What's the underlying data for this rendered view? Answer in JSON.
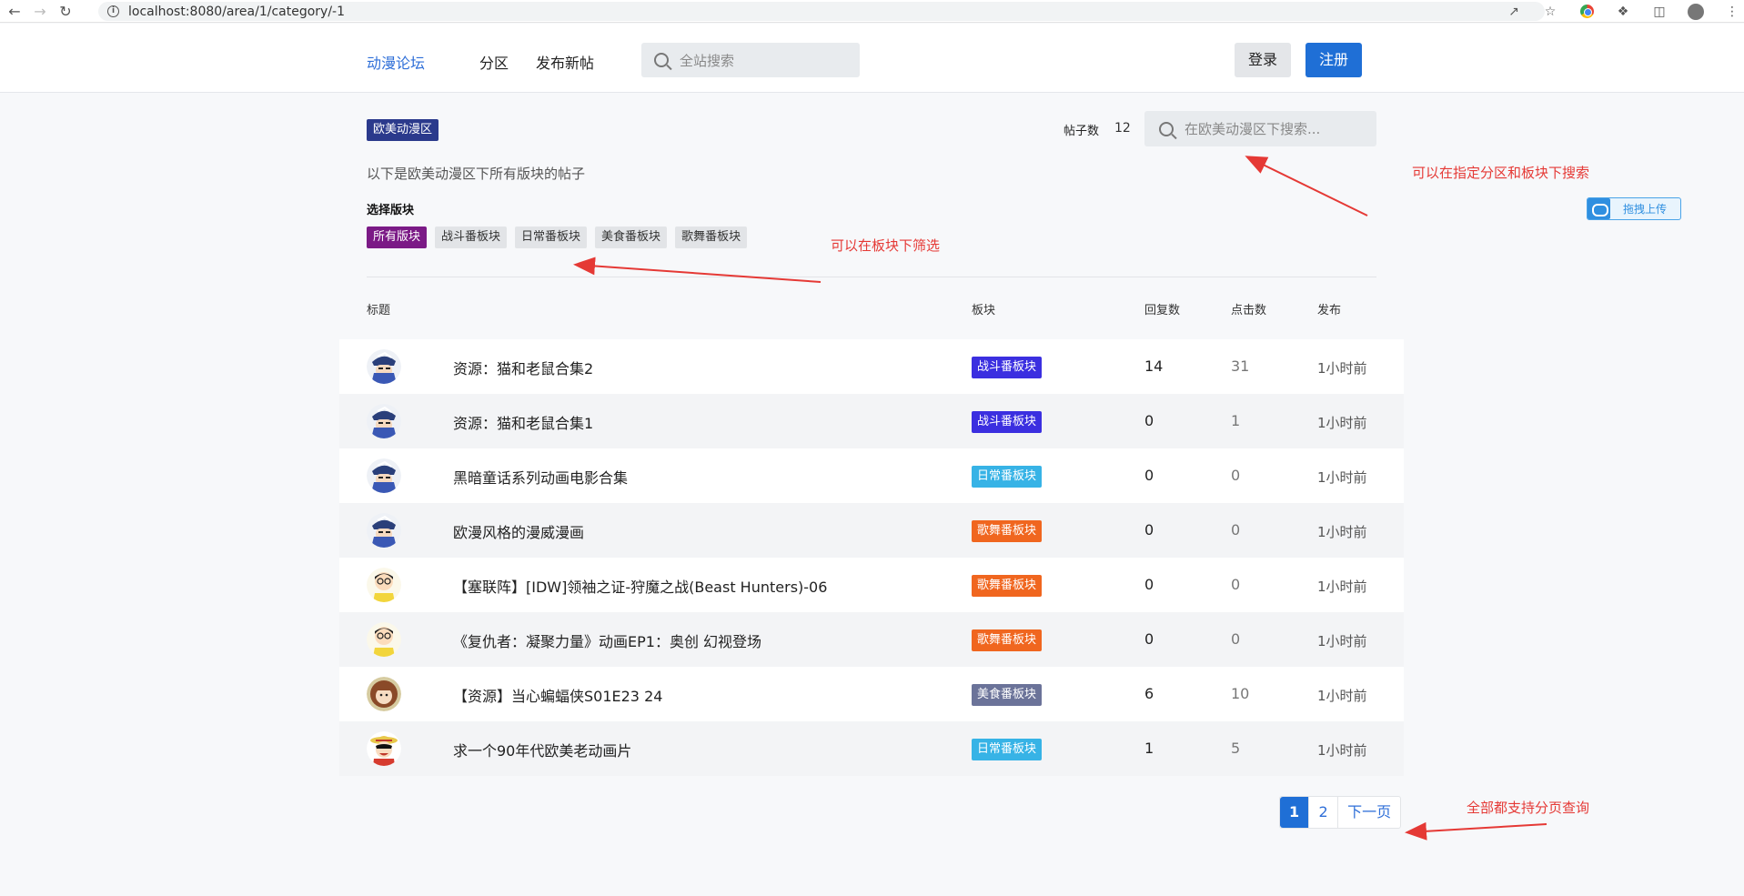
{
  "browser": {
    "url": "localhost:8080/area/1/category/-1"
  },
  "header": {
    "logo": "动漫论坛",
    "nav": [
      "分区",
      "发布新帖"
    ],
    "search_placeholder": "全站搜索",
    "login_label": "登录",
    "register_label": "注册"
  },
  "area": {
    "badge": "欧美动漫区",
    "post_count_label": "帖子数",
    "post_count": "12",
    "search_placeholder": "在欧美动漫区下搜索...",
    "description": "以下是欧美动漫区下所有版块的帖子",
    "category_label": "选择版块",
    "categories": [
      "所有版块",
      "战斗番板块",
      "日常番板块",
      "美食番板块",
      "歌舞番板块"
    ]
  },
  "table": {
    "headers": [
      "标题",
      "板块",
      "回复数",
      "点击数",
      "发布"
    ],
    "rows": [
      {
        "title": "资源：猫和老鼠合集2",
        "category": "战斗番板块",
        "replies": "14",
        "clicks": "31",
        "time": "1小时前",
        "avatar": "kid-avatar"
      },
      {
        "title": "资源：猫和老鼠合集1",
        "category": "战斗番板块",
        "replies": "0",
        "clicks": "1",
        "time": "1小时前",
        "avatar": "kid-avatar"
      },
      {
        "title": "黑暗童话系列动画电影合集",
        "category": "日常番板块",
        "replies": "0",
        "clicks": "0",
        "time": "1小时前",
        "avatar": "kid-avatar"
      },
      {
        "title": "欧漫风格的漫威漫画",
        "category": "歌舞番板块",
        "replies": "0",
        "clicks": "0",
        "time": "1小时前",
        "avatar": "kid-avatar"
      },
      {
        "title": "【塞联阵】[IDW]领袖之证-狩魔之战(Beast Hunters)-06",
        "category": "歌舞番板块",
        "replies": "0",
        "clicks": "0",
        "time": "1小时前",
        "avatar": "nobita-avatar"
      },
      {
        "title": "《复仇者：凝聚力量》动画EP1：奥创 幻视登场",
        "category": "歌舞番板块",
        "replies": "0",
        "clicks": "0",
        "time": "1小时前",
        "avatar": "nobita-avatar"
      },
      {
        "title": "【资源】当心蝙蝠侠S01E23 24",
        "category": "美食番板块",
        "replies": "6",
        "clicks": "10",
        "time": "1小时前",
        "avatar": "girl-avatar"
      },
      {
        "title": "求一个90年代欧美老动画片",
        "category": "日常番板块",
        "replies": "1",
        "clicks": "5",
        "time": "1小时前",
        "avatar": "luffy-avatar"
      }
    ]
  },
  "category_colors": {
    "战斗番板块": "#3b2fe0",
    "日常番板块": "#37b3e6",
    "歌舞番板块": "#f0661f",
    "美食番板块": "#6b7399"
  },
  "pagination": {
    "pages": [
      "1",
      "2"
    ],
    "next_label": "下一页",
    "current": "1"
  },
  "annotations": {
    "search_note": "可以在指定分区和板块下搜索",
    "filter_note": "可以在板块下筛选",
    "paging_note": "全部都支持分页查询"
  },
  "upload_widget": {
    "label": "拖拽上传"
  }
}
